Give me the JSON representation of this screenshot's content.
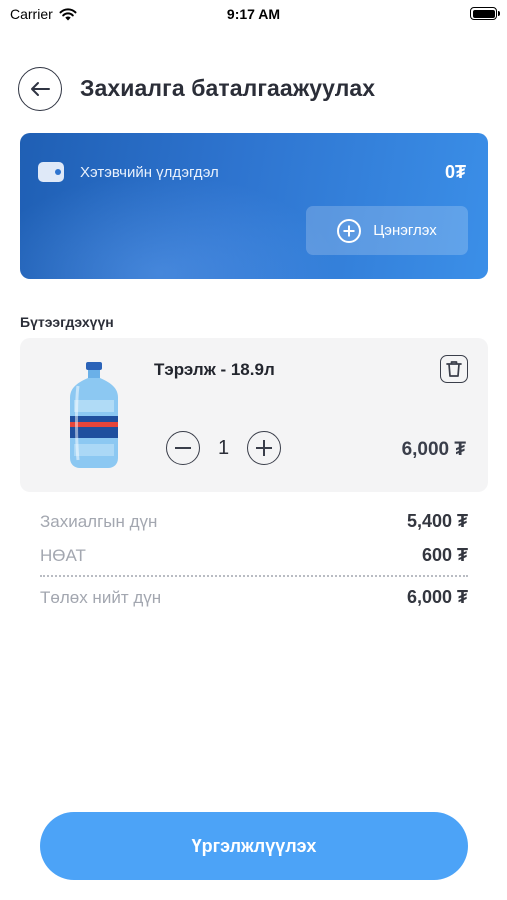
{
  "status_bar": {
    "carrier": "Carrier",
    "time": "9:17 AM"
  },
  "header": {
    "title": "Захиалга баталгаажуулах",
    "back_icon": "arrow-left-icon"
  },
  "wallet": {
    "label": "Хэтэвчийн үлдэгдэл",
    "balance": "0₮",
    "topup_label": "Цэнэглэх",
    "colors": {
      "gradient_start": "#1f5fb4",
      "gradient_end": "#3b8fe8"
    }
  },
  "product_section": {
    "label": "Бүтээгдэхүүн",
    "items": [
      {
        "name": "Тэрэлж - 18.9л",
        "quantity": "1",
        "price": "6,000 ₮",
        "image_icon": "water-bottle-image"
      }
    ]
  },
  "summary": {
    "subtotal_label": "Захиалгын дүн",
    "subtotal_value": "5,400 ₮",
    "vat_label": "НӨАТ",
    "vat_value": "600 ₮",
    "total_label": "Төлөх нийт дүн",
    "total_value": "6,000 ₮"
  },
  "actions": {
    "continue_label": "Үргэлжлүүлэх",
    "accent_color": "#4ca3f7"
  }
}
